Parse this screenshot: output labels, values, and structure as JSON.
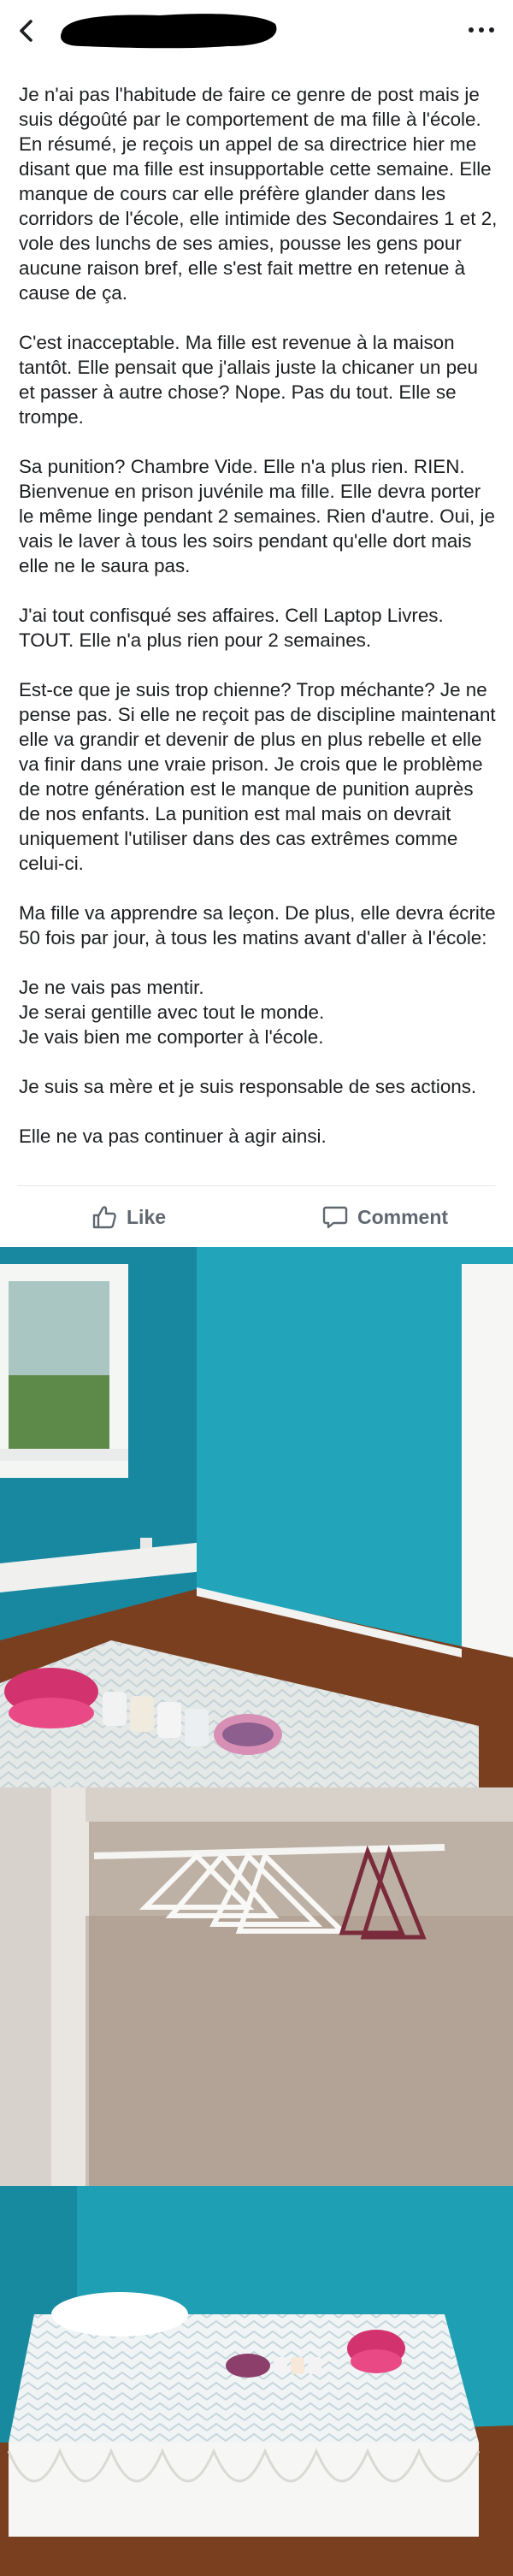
{
  "post": {
    "paragraphs": [
      "Je n'ai pas l'habitude de faire ce genre de post mais je suis dégoûté par le comportement de ma fille à l'école. En résumé, je reçois un appel de sa directrice hier me disant que ma fille est insupportable cette semaine. Elle manque de cours car elle préfère glander dans les corridors de l'école, elle intimide des Secondaires 1 et 2, vole des lunchs de ses amies, pousse les gens pour aucune raison bref, elle s'est fait mettre en retenue à cause de ça.",
      "C'est inacceptable. Ma fille est revenue à la maison tantôt. Elle pensait que j'allais juste la chicaner un peu et passer à autre chose? Nope. Pas du tout. Elle se trompe.",
      "Sa punition? Chambre Vide. Elle n'a plus rien. RIEN. Bienvenue en prison juvénile ma fille. Elle devra porter le même linge pendant 2 semaines. Rien d'autre. Oui, je vais le laver à tous les soirs pendant qu'elle dort mais elle ne le saura pas.",
      "J'ai tout confisqué ses affaires. Cell Laptop Livres. TOUT. Elle n'a plus rien pour 2 semaines.",
      "Est-ce que je suis trop chienne? Trop méchante? Je ne pense pas. Si elle ne reçoit pas de discipline maintenant elle va grandir et devenir de plus en plus rebelle et elle va finir dans une vraie prison. Je crois que le problème de notre génération est le manque de punition auprès de nos enfants. La punition est mal mais on devrait uniquement l'utiliser dans des cas extrêmes comme celui-ci.",
      "Ma fille va apprendre sa leçon. De plus, elle devra écrite 50 fois par jour, à tous les matins avant d'aller à l'école:",
      "Je ne vais pas mentir.\nJe serai gentille avec tout le monde.\nJe vais bien me comporter à l'école.",
      "Je suis sa mère et je suis responsable de ses actions.",
      "Elle ne va pas continuer à agir ainsi."
    ]
  },
  "actions": {
    "like_label": "Like",
    "comment_label": "Comment"
  },
  "icons": {
    "back": "chevron-left-icon",
    "more": "more-options-icon",
    "like": "thumbs-up-icon",
    "comment": "comment-bubble-icon"
  },
  "colors": {
    "wall": "#1e9fb3",
    "floor": "#7a3f1f",
    "action_text": "#606770"
  }
}
